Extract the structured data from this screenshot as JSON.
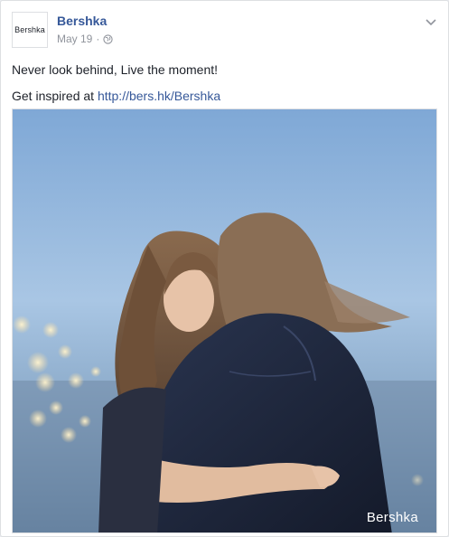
{
  "post": {
    "author": {
      "name": "Bershka",
      "avatar_text": "Bershka"
    },
    "date": "May 19",
    "separator": "·",
    "privacy_icon": "globe-icon",
    "menu_icon": "chevron-down-icon",
    "text_line1": "Never look behind, Live the moment!",
    "text_line2_prefix": "Get inspired at",
    "link": "http://bers.hk/Bershka",
    "photo": {
      "watermark": "Bershka"
    }
  },
  "colors": {
    "link": "#365899",
    "meta": "#90949c",
    "text": "#1d2129",
    "sky": "#8fb2d8"
  }
}
